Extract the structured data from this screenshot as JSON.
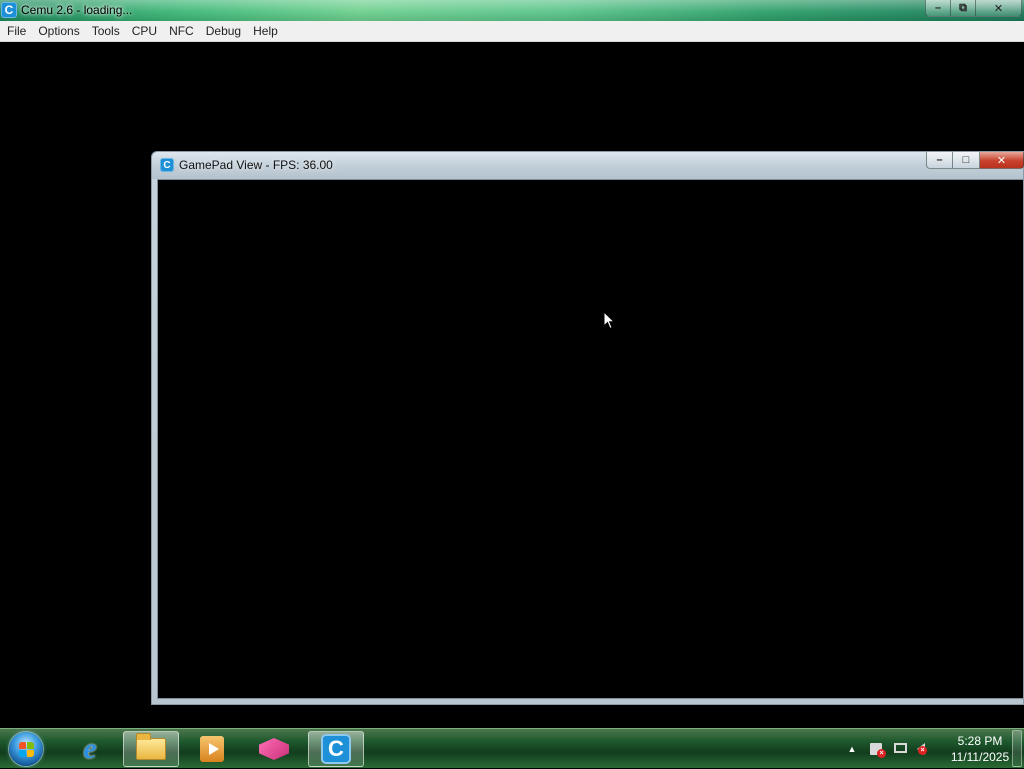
{
  "main_window": {
    "icon_letter": "C",
    "title": "Cemu 2.6 - loading...",
    "controls": {
      "minimize": "–",
      "maximize": "⧉",
      "close": "✕"
    }
  },
  "menu": {
    "items": [
      "File",
      "Options",
      "Tools",
      "CPU",
      "NFC",
      "Debug",
      "Help"
    ]
  },
  "gamepad_window": {
    "icon_letter": "C",
    "title": "GamePad View - FPS: 36.00",
    "controls": {
      "minimize": "–",
      "maximize": "□",
      "close": "✕"
    }
  },
  "taskbar": {
    "pinned": [
      {
        "name": "internet-explorer",
        "icon": "ie-icon",
        "glyph": "e"
      },
      {
        "name": "windows-explorer",
        "icon": "folder-icon"
      },
      {
        "name": "media-player",
        "icon": "media-play-icon"
      },
      {
        "name": "app-box",
        "icon": "box-icon"
      },
      {
        "name": "cemu",
        "icon": "cemu-icon",
        "glyph": "C"
      }
    ],
    "tray": {
      "arrow": "▲",
      "time": "5:28 PM",
      "date": "11/11/2025"
    }
  },
  "colors": {
    "cemu_blue": "#1e90d8",
    "titlebar_green": "#3fb878",
    "taskbar_green": "#1f5a2e"
  }
}
